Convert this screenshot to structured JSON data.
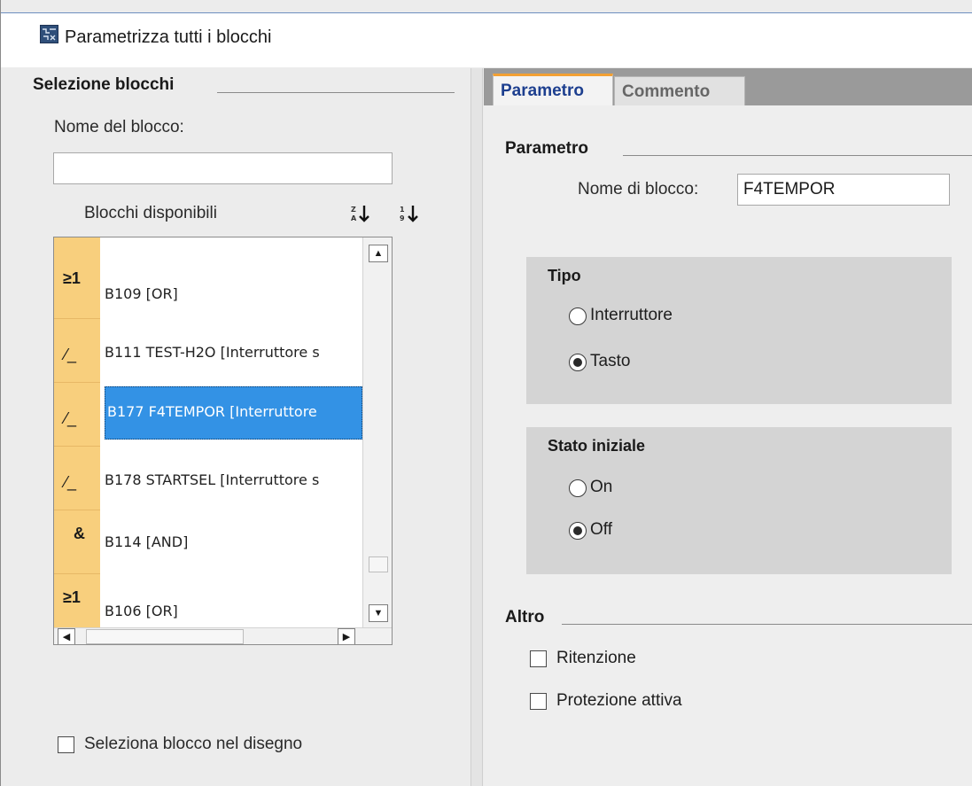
{
  "window": {
    "title": "Parametrizza tutti i blocchi"
  },
  "left": {
    "section_title": "Selezione blocchi",
    "name_label": "Nome del blocco:",
    "name_value": "",
    "list_header": "Blocchi disponibili",
    "sort_alpha_icon": "sort-alpha-icon",
    "sort_numeric_icon": "sort-numeric-icon",
    "items": [
      {
        "symbol": "≥1",
        "text": "B109 [OR]"
      },
      {
        "symbol": "⁄_",
        "text": "B111 TEST-H2O [Interruttore s"
      },
      {
        "symbol": "⁄_",
        "text": "B177 F4TEMPOR [Interruttore"
      },
      {
        "symbol": "⁄_",
        "text": "B178 STARTSEL [Interruttore s"
      },
      {
        "symbol": "&",
        "text": "B114 [AND]"
      },
      {
        "symbol": "≥1",
        "text": "B106 [OR]"
      }
    ],
    "selected_index": 2,
    "select_in_drawing_label": "Seleziona blocco nel disegno"
  },
  "tabs": [
    {
      "label": "Parametro"
    },
    {
      "label": "Commento"
    }
  ],
  "right": {
    "param_section": "Parametro",
    "block_name_label": "Nome di blocco:",
    "block_name_value": "F4TEMPOR",
    "tipo": {
      "title": "Tipo",
      "options": [
        "Interruttore",
        "Tasto"
      ],
      "selected": "Tasto"
    },
    "stato": {
      "title": "Stato iniziale",
      "options": [
        "On",
        "Off"
      ],
      "selected": "Off"
    },
    "altro": {
      "title": "Altro",
      "ritenzione": "Ritenzione",
      "protezione": "Protezione attiva"
    }
  },
  "colors": {
    "block_icon_bg": "#f8cf7d",
    "selection": "#3392e5",
    "active_tab_accent": "#f2a033"
  }
}
